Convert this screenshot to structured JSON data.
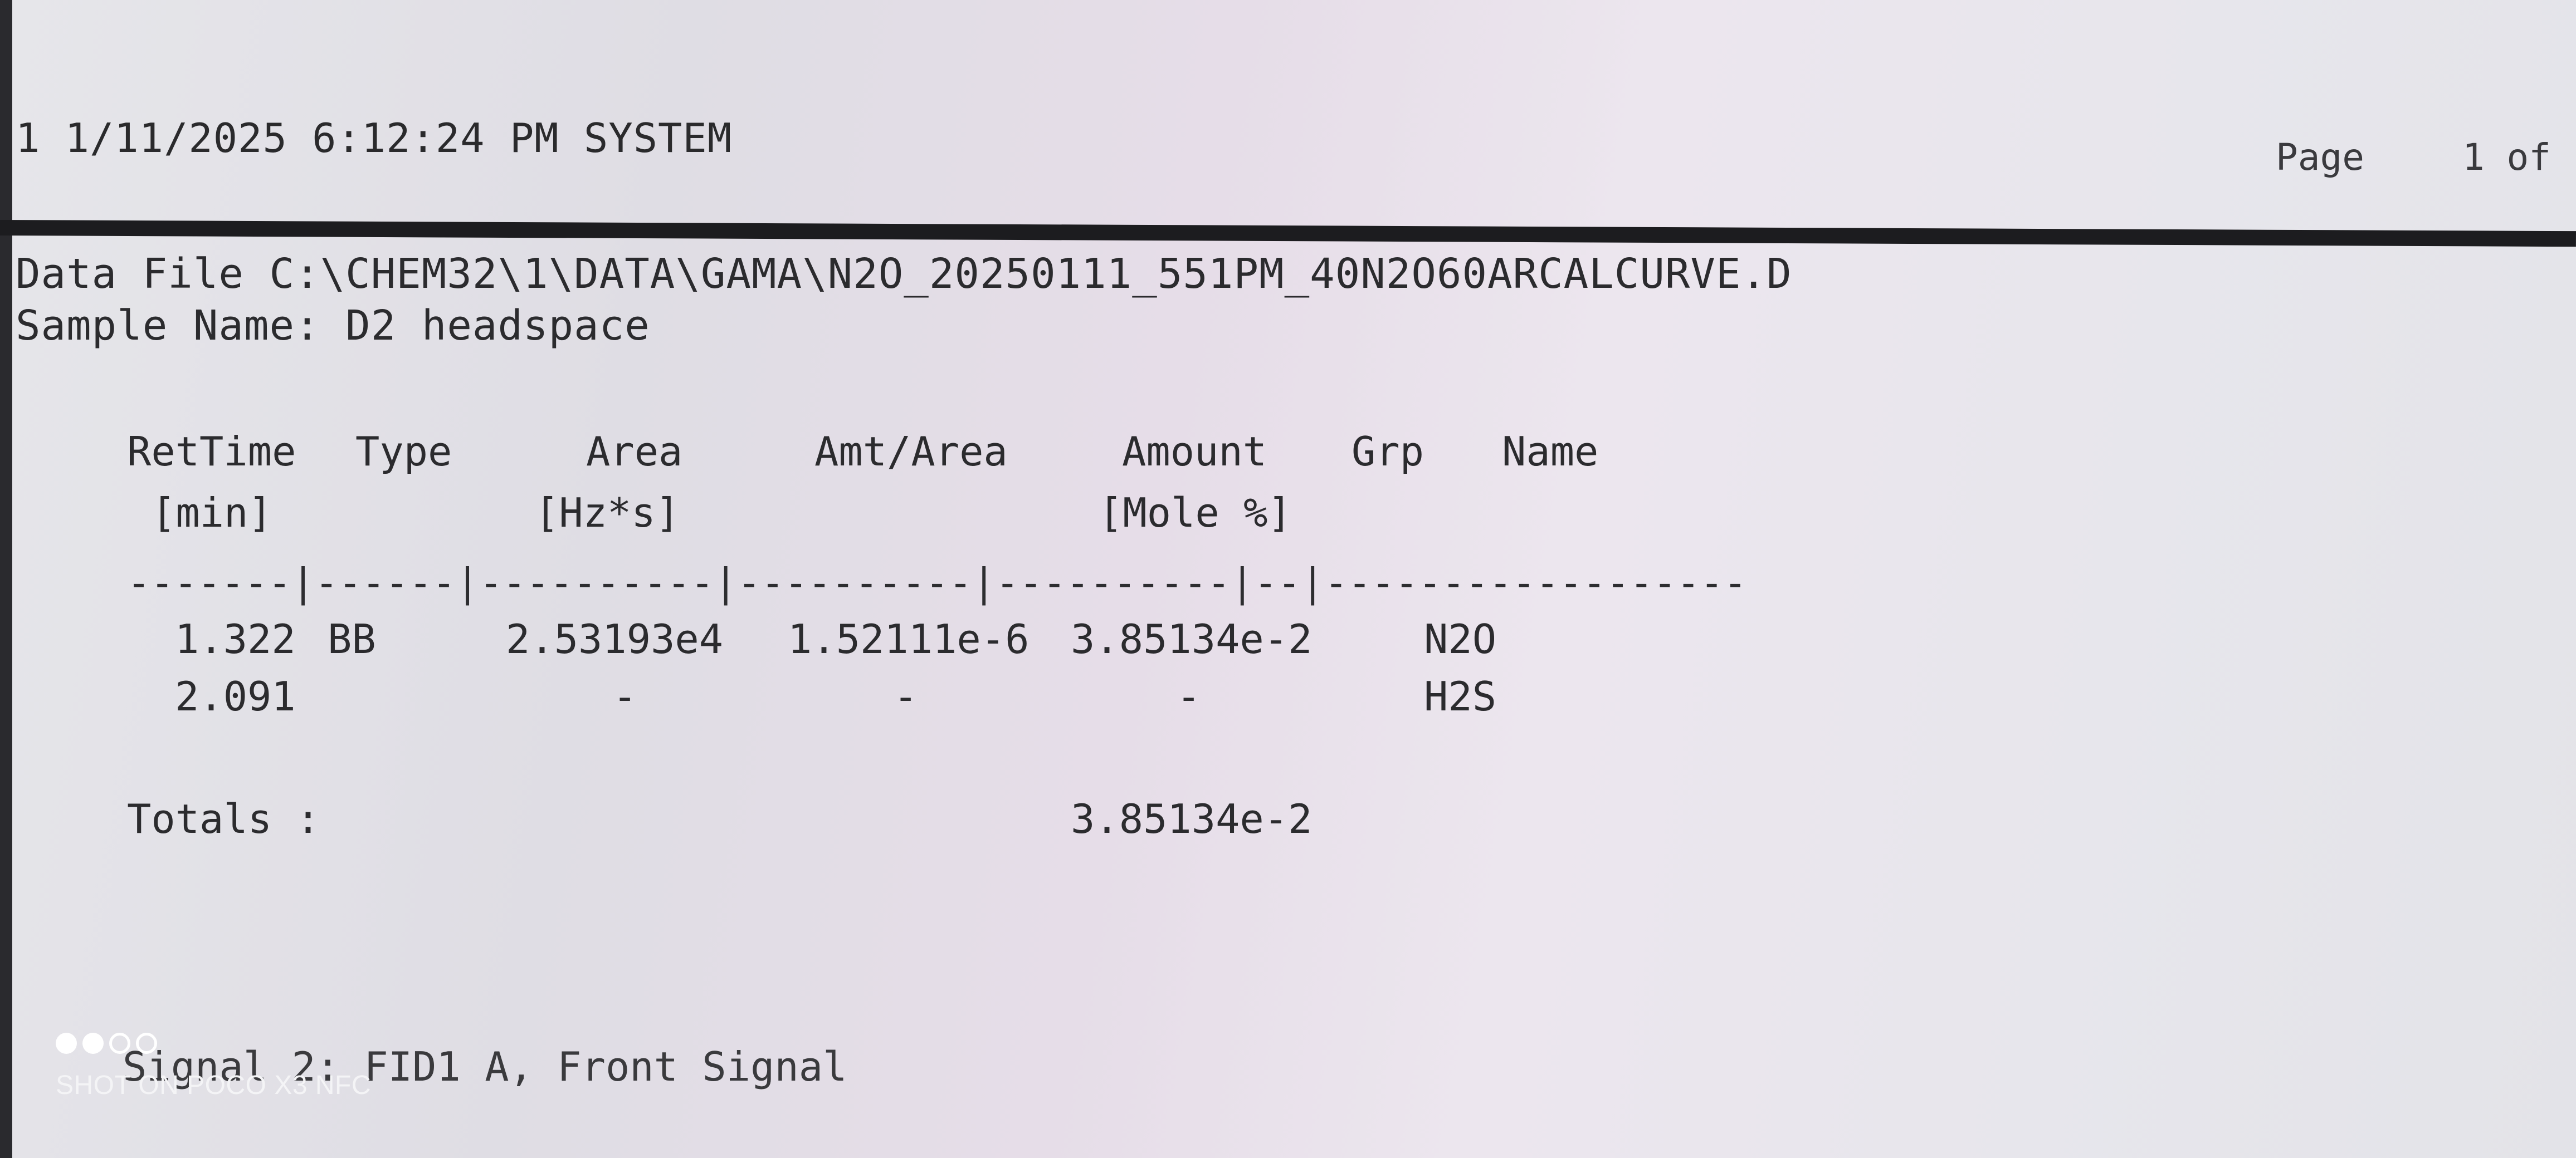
{
  "header": {
    "line": "1 1/11/2025 6:12:24 PM SYSTEM",
    "page_label": "Page",
    "page_text": "1 of"
  },
  "report": {
    "data_file": "Data File C:\\CHEM32\\1\\DATA\\GAMA\\N2O_20250111_551PM_40N2O60ARCALCURVE.D",
    "sample_name": "Sample Name: D2 headspace"
  },
  "table": {
    "headers": {
      "rettime": "RetTime",
      "type": "Type",
      "area": "Area",
      "amt_area": "Amt/Area",
      "amount": "Amount",
      "grp": "Grp",
      "name": "Name"
    },
    "units": {
      "rettime": "[min]",
      "area": "[Hz*s]",
      "amount": "[Mole %]"
    },
    "separator": "-------|------|----------|----------|----------|--|------------------",
    "rows": [
      {
        "rettime": "1.322",
        "type": "BB",
        "area": "2.53193e4",
        "amt_area": "1.52111e-6",
        "amount": "3.85134e-2",
        "grp": "",
        "name": "N2O"
      },
      {
        "rettime": "2.091",
        "type": "",
        "area": "-",
        "amt_area": "-",
        "amount": "-",
        "grp": "",
        "name": "H2S"
      }
    ],
    "totals_label": "Totals :",
    "totals_value": "3.85134e-2"
  },
  "footer": {
    "signal": "Signal 2: FID1 A, Front Signal"
  },
  "watermark": {
    "text": "SHOT ON POCO X3 NFC"
  }
}
